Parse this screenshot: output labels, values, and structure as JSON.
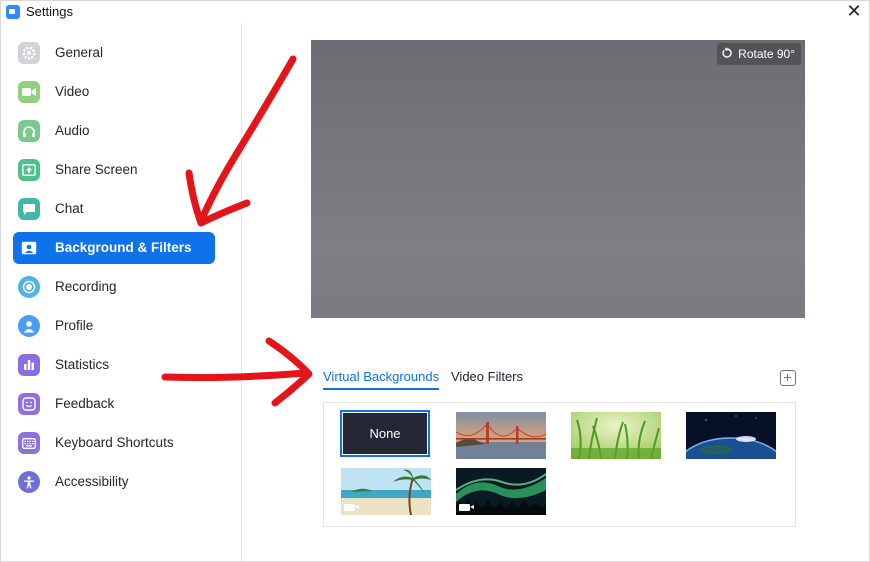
{
  "window": {
    "title": "Settings",
    "close_glyph": "✕"
  },
  "sidebar": {
    "items": [
      {
        "id": "general",
        "label": "General",
        "icon": "gear-icon",
        "color": "#c9c9cf",
        "active": false
      },
      {
        "id": "video",
        "label": "Video",
        "icon": "video-camera-icon",
        "color": "#8fd17c",
        "active": false
      },
      {
        "id": "audio",
        "label": "Audio",
        "icon": "headphones-icon",
        "color": "#7cc98f",
        "active": false
      },
      {
        "id": "share-screen",
        "label": "Share Screen",
        "icon": "share-screen-icon",
        "color": "#4cc38a",
        "active": false
      },
      {
        "id": "chat",
        "label": "Chat",
        "icon": "chat-bubble-icon",
        "color": "#3fb8a8",
        "active": false
      },
      {
        "id": "background-filters",
        "label": "Background & Filters",
        "icon": "person-portrait-icon",
        "color": "#0e72ed",
        "active": true
      },
      {
        "id": "recording",
        "label": "Recording",
        "icon": "record-icon",
        "color": "#4fb3e8",
        "active": false
      },
      {
        "id": "profile",
        "label": "Profile",
        "icon": "profile-icon",
        "color": "#4a9ef0",
        "active": false
      },
      {
        "id": "statistics",
        "label": "Statistics",
        "icon": "bar-chart-icon",
        "color": "#8a6fe0",
        "active": false
      },
      {
        "id": "feedback",
        "label": "Feedback",
        "icon": "smiley-icon",
        "color": "#8f70de",
        "active": false
      },
      {
        "id": "keyboard-shortcuts",
        "label": "Keyboard Shortcuts",
        "icon": "keyboard-icon",
        "color": "#8a72dc",
        "active": false
      },
      {
        "id": "accessibility",
        "label": "Accessibility",
        "icon": "accessibility-icon",
        "color": "#6f6fd6",
        "active": false
      }
    ]
  },
  "preview": {
    "rotate_label": "Rotate 90°",
    "rotate_icon": "rotate-icon"
  },
  "tabs": {
    "virtual_backgrounds": "Virtual Backgrounds",
    "video_filters": "Video Filters"
  },
  "backgrounds": {
    "none_label": "None",
    "items": [
      {
        "name": "bg-thumb-golden-gate",
        "scene": "golden-gate-bridge"
      },
      {
        "name": "bg-thumb-grass",
        "scene": "grass"
      },
      {
        "name": "bg-thumb-earth",
        "scene": "earth-from-space"
      },
      {
        "name": "bg-thumb-beach",
        "scene": "beach-palm",
        "is_video": true
      },
      {
        "name": "bg-thumb-aurora",
        "scene": "aurora",
        "is_video": true
      }
    ]
  },
  "colors": {
    "accent": "#0e72ed",
    "annotation_red": "#e3151a"
  }
}
